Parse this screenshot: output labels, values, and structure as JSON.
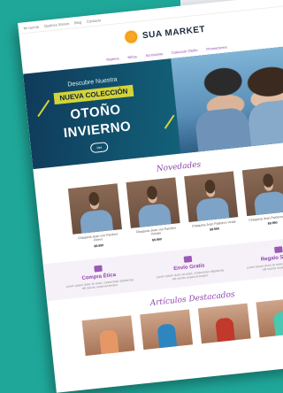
{
  "topbar": {
    "links": [
      "Mi cuenta",
      "Quiénes Somos",
      "Blog",
      "Contacto"
    ],
    "icons": [
      "search-icon",
      "user-icon",
      "cart-icon"
    ]
  },
  "brand": {
    "name": "SUA MARKET"
  },
  "nav": [
    "Mujeres",
    "Niños",
    "Accesorios",
    "Colección Otoño",
    "Promociones"
  ],
  "hero": {
    "kicker": "Descubre Nuestra",
    "badge": "NUEVA COLECCIÓN",
    "title_line1": "OTOÑO",
    "title_line2": "INVIERNO",
    "button": "Ver"
  },
  "sections": {
    "new": "Novedades",
    "featured": "Artículos Destacados"
  },
  "products": [
    {
      "name": "Chaqueta Jean con Parches Flores",
      "price": "$9.990"
    },
    {
      "name": "Chaqueta Jean con Parches Rockie",
      "price": "$9.990"
    },
    {
      "name": "Chaqueta Jean Pastoreo Verde",
      "price": "$9.990"
    },
    {
      "name": "Chaqueta Jean Pastoreo Vintage",
      "price": "$9.990"
    }
  ],
  "features": [
    {
      "title": "Compra Ética",
      "icon": "shirt-icon",
      "desc": "Lorem ipsum dolor sit amet, consectetur adipiscing elit sed do eiusmod tempor"
    },
    {
      "title": "Envío Gratis",
      "icon": "truck-icon",
      "desc": "Lorem ipsum dolor sit amet, consectetur adipiscing elit sed do eiusmod tempor"
    },
    {
      "title": "Regalo Seguro",
      "icon": "gift-icon",
      "desc": "Lorem ipsum dolor sit amet, consectetur adipiscing elit sed do eiusmod tempor"
    }
  ],
  "colors": {
    "accent": "#8e44ad",
    "hero": "#13627a",
    "badge": "#d4d43a",
    "background": "#1fa89a"
  }
}
